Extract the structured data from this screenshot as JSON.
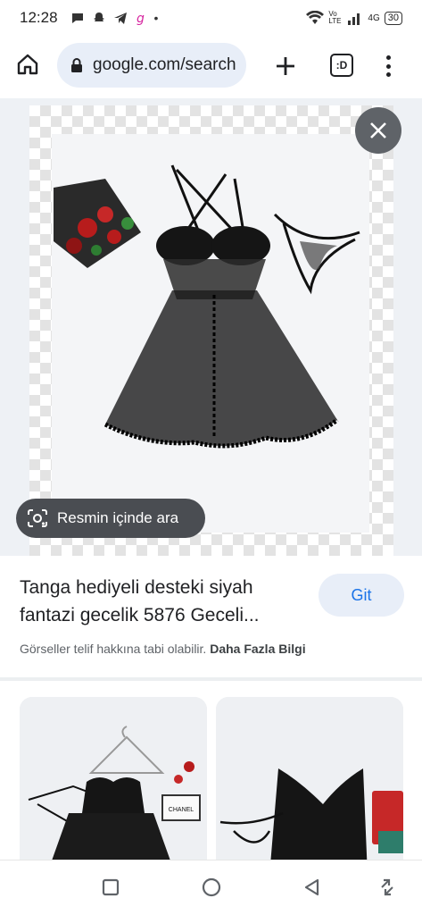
{
  "status_bar": {
    "time": "12:28",
    "notif_dot": "•",
    "network": "4G",
    "volte": "Vo LTE",
    "battery": "30"
  },
  "browser": {
    "url": "google.com/search",
    "tab_count": ":D"
  },
  "viewer": {
    "lens_label": "Resmin içinde ara"
  },
  "result": {
    "title": "Tanga hediyeli desteki siyah fantazi gecelik 5876 Geceli...",
    "go_label": "Git",
    "copyright_text": "Görseller telif hakkına tabi olabilir.",
    "more_info_label": "Daha Fazla Bilgi"
  },
  "thumbnails": {
    "box_text": "CHANEL"
  },
  "colors": {
    "accent": "#1a73e8",
    "pill_bg": "#e8eef8",
    "chip_bg": "#4a4d52",
    "close_bg": "#5f6368"
  }
}
